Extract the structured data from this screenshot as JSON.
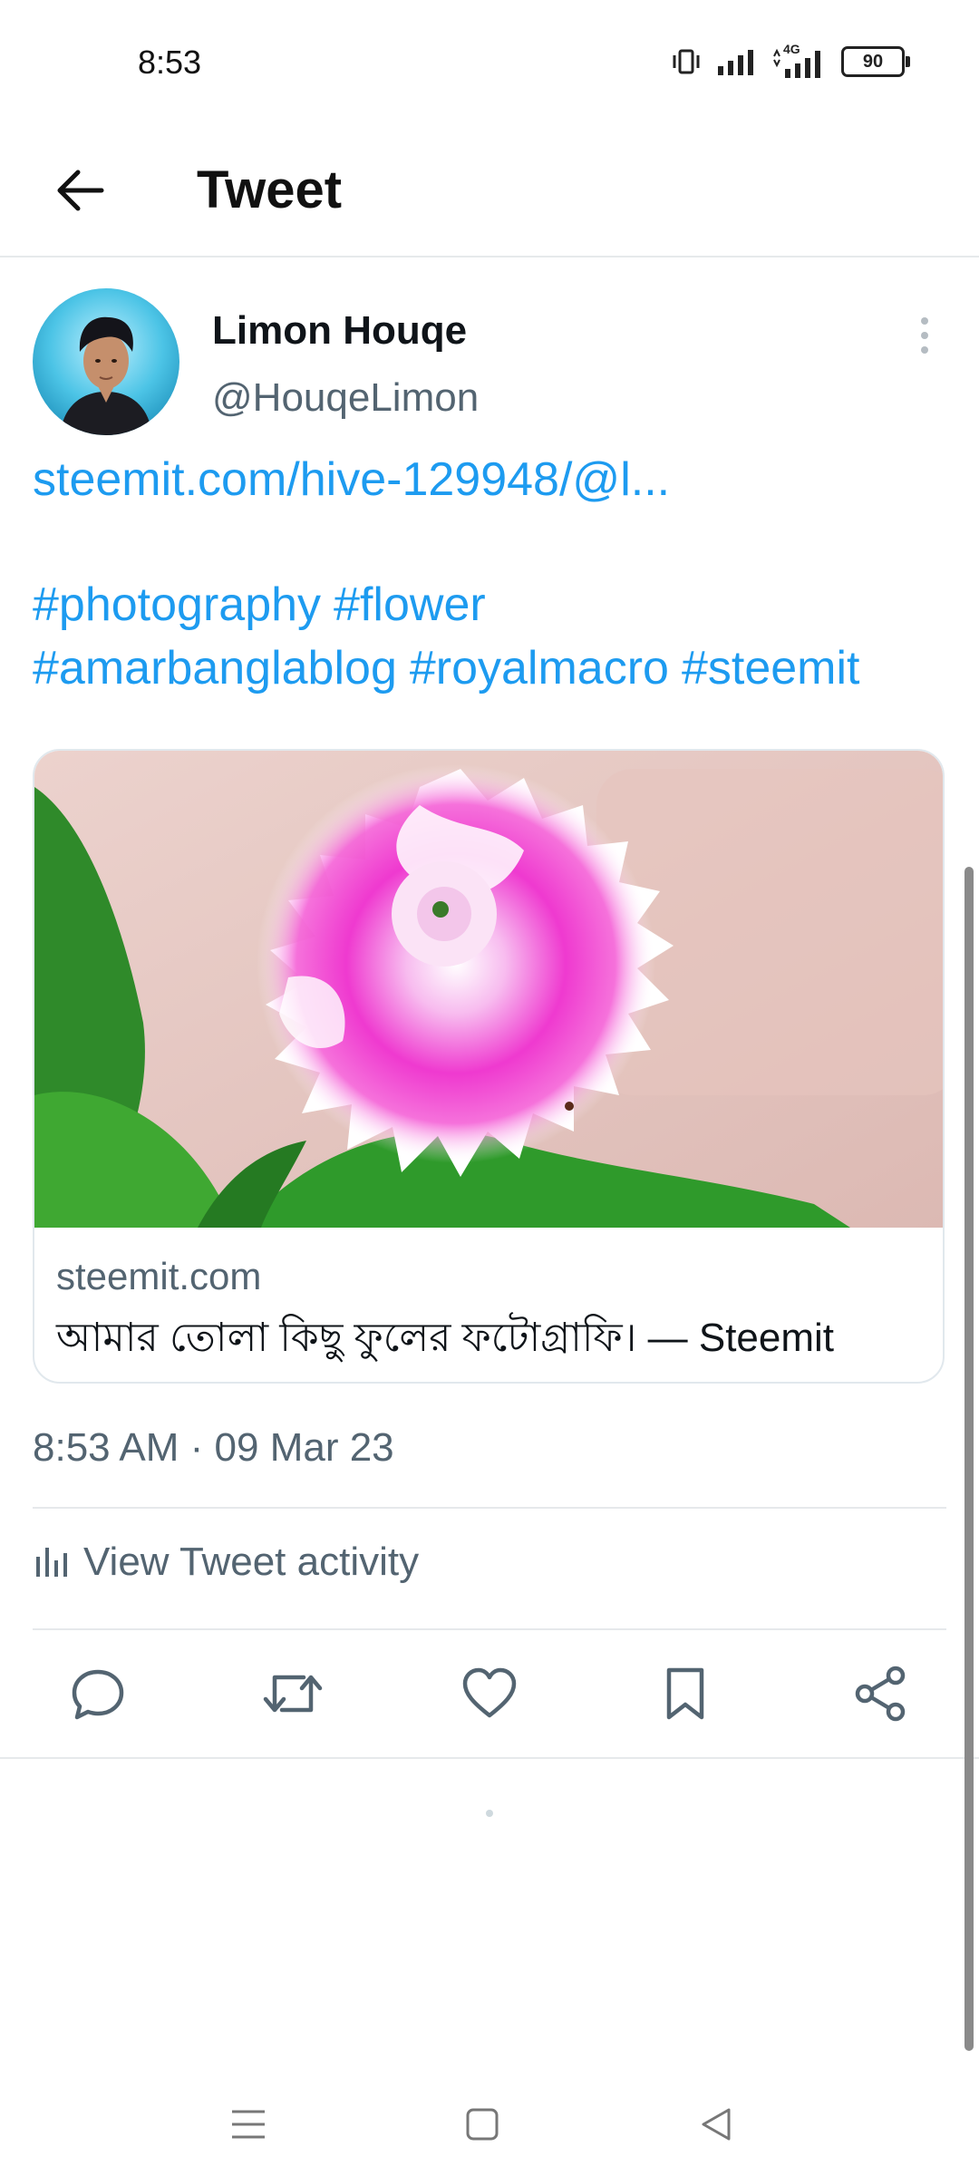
{
  "status_bar": {
    "time": "8:53",
    "network": "4G",
    "battery": "90"
  },
  "header": {
    "title": "Tweet"
  },
  "tweet": {
    "author_name": "Limon Houqe",
    "author_handle": "@HouqeLimon",
    "link_text": "steemit.com/hive-129948/@l...",
    "hashtags": [
      "#photography",
      "#flower",
      "#amarbanglablog",
      "#royalmacro",
      "#steemit"
    ],
    "timestamp": "8:53 AM · 09 Mar 23",
    "activity_label": "View Tweet activity"
  },
  "link_card": {
    "domain": "steemit.com",
    "title": "আমার তোলা কিছু ফুলের ফটোগ্রাফি। — Steemit"
  },
  "icons": {
    "back": "arrow-left-icon",
    "more": "kebab-menu-icon",
    "reply": "speech-bubble-icon",
    "retweet": "retweet-icon",
    "like": "heart-icon",
    "bookmark": "bookmark-icon",
    "share": "share-icon",
    "activity": "bar-chart-icon"
  },
  "colors": {
    "link": "#1d9bf0",
    "secondary_text": "#536471",
    "primary_text": "#0f1419"
  }
}
